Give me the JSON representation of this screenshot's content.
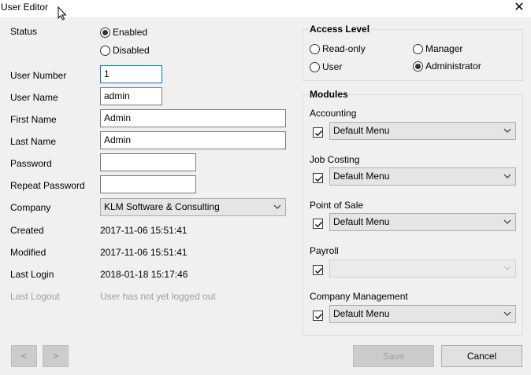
{
  "window": {
    "title": "User Editor",
    "close_glyph": "✕"
  },
  "form": {
    "status_label": "Status",
    "status_options": {
      "enabled": "Enabled",
      "disabled": "Disabled"
    },
    "user_number_label": "User Number",
    "user_number_value": "1",
    "user_name_label": "User Name",
    "user_name_value": "admin",
    "first_name_label": "First Name",
    "first_name_value": "Admin",
    "last_name_label": "Last Name",
    "last_name_value": "Admin",
    "password_label": "Password",
    "password_value": "",
    "repeat_password_label": "Repeat Password",
    "repeat_password_value": "",
    "company_label": "Company",
    "company_value": "KLM Software & Consulting",
    "created_label": "Created",
    "created_value": "2017-11-06 15:51:41",
    "modified_label": "Modified",
    "modified_value": "2017-11-06 15:51:41",
    "last_login_label": "Last Login",
    "last_login_value": "2018-01-18 15:17:46",
    "last_logout_label": "Last Logout",
    "last_logout_value": "User has not yet logged out"
  },
  "access_level": {
    "title": "Access Level",
    "options": {
      "read_only": "Read-only",
      "manager": "Manager",
      "user": "User",
      "administrator": "Administrator"
    },
    "selected": "Administrator"
  },
  "modules": {
    "title": "Modules",
    "items": [
      {
        "label": "Accounting",
        "checked": true,
        "value": "Default Menu",
        "enabled": true
      },
      {
        "label": "Job Costing",
        "checked": true,
        "value": "Default Menu",
        "enabled": true
      },
      {
        "label": "Point of Sale",
        "checked": true,
        "value": "Default Menu",
        "enabled": true
      },
      {
        "label": "Payroll",
        "checked": true,
        "value": "",
        "enabled": false
      },
      {
        "label": "Company Management",
        "checked": true,
        "value": "Default Menu",
        "enabled": true
      }
    ]
  },
  "footer": {
    "prev_glyph": "<",
    "next_glyph": ">",
    "save_label": "Save",
    "cancel_label": "Cancel"
  }
}
